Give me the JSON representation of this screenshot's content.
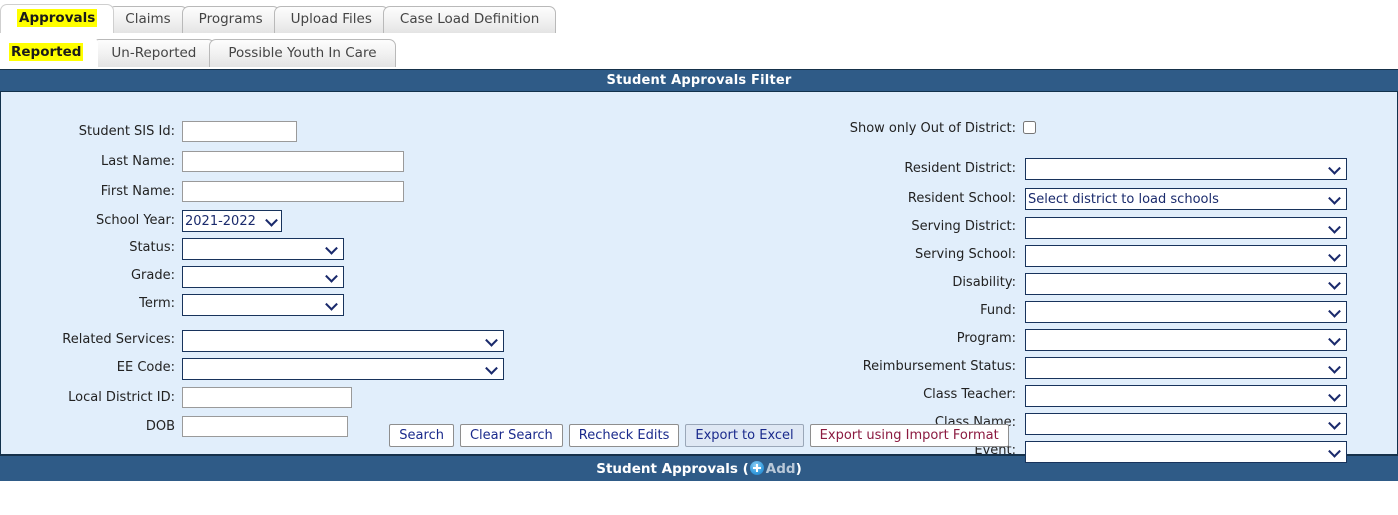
{
  "tabs_primary": [
    {
      "label": "Approvals",
      "active": true
    },
    {
      "label": "Claims",
      "active": false
    },
    {
      "label": "Programs",
      "active": false
    },
    {
      "label": "Upload Files",
      "active": false
    },
    {
      "label": "Case Load Definition",
      "active": false
    }
  ],
  "tabs_secondary": [
    {
      "label": "Reported",
      "active": true
    },
    {
      "label": "Un-Reported",
      "active": false
    },
    {
      "label": "Possible Youth In Care",
      "active": false
    }
  ],
  "panel": {
    "header_title": "Student Approvals Filter"
  },
  "left_fields": {
    "student_sis_id_label": "Student SIS Id:",
    "student_sis_id_value": "",
    "last_name_label": "Last Name:",
    "last_name_value": "",
    "first_name_label": "First Name:",
    "first_name_value": "",
    "school_year_label": "School Year:",
    "school_year_value": "2021-2022",
    "status_label": "Status:",
    "status_value": "",
    "grade_label": "Grade:",
    "grade_value": "",
    "term_label": "Term:",
    "term_value": "",
    "related_services_label": "Related Services:",
    "related_services_value": "",
    "ee_code_label": "EE Code:",
    "ee_code_value": "",
    "local_district_id_label": "Local District ID:",
    "local_district_id_value": "",
    "dob_label": "DOB",
    "dob_value": ""
  },
  "right_fields": {
    "show_only_out_of_district_label": "Show only Out of District:",
    "show_only_out_of_district_checked": false,
    "resident_district_label": "Resident District:",
    "resident_district_value": "",
    "resident_school_label": "Resident School:",
    "resident_school_value": "Select district to load schools",
    "serving_district_label": "Serving District:",
    "serving_district_value": "",
    "serving_school_label": "Serving School:",
    "serving_school_value": "",
    "disability_label": "Disability:",
    "disability_value": "",
    "fund_label": "Fund:",
    "fund_value": "",
    "program_label": "Program:",
    "program_value": "",
    "reimbursement_status_label": "Reimbursement Status:",
    "reimbursement_status_value": "",
    "class_teacher_label": "Class Teacher:",
    "class_teacher_value": "",
    "class_name_label": "Class Name:",
    "class_name_value": "",
    "event_label": "Event:",
    "event_value": ""
  },
  "buttons": {
    "search": "Search",
    "clear_search": "Clear Search",
    "recheck_edits": "Recheck Edits",
    "export_to_excel": "Export to Excel",
    "export_using_import_format": "Export using Import Format"
  },
  "footer": {
    "title": "Student Approvals",
    "open_paren": "(",
    "add_label": "Add",
    "close_paren": ")",
    "add_icon": "circle-plus-icon"
  },
  "colors": {
    "header_bar": "#2f5b87",
    "panel_body": "#e1eefb",
    "active_tab_highlight": "#ffff00",
    "select_border": "#18335c",
    "button_text": "#1a2a8c",
    "import_format_text": "#8b1a40",
    "excel_button_bg": "#dfe8f4"
  }
}
